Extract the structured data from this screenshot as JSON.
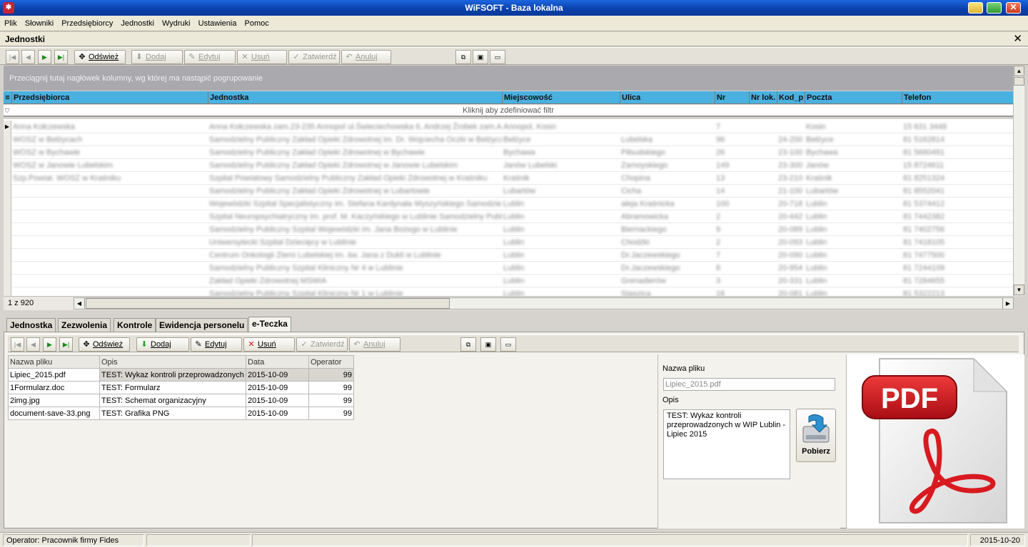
{
  "window": {
    "title": "WiFSOFT - Baza lokalna"
  },
  "menu": [
    "Plik",
    "Słowniki",
    "Przedsiębiorcy",
    "Jednostki",
    "Wydruki",
    "Ustawienia",
    "Pomoc"
  ],
  "panel": {
    "title": "Jednostki"
  },
  "toolbar": {
    "refresh": "Odśwież",
    "add": "Dodaj",
    "edit": "Edytuj",
    "delete": "Usuń",
    "confirm": "Zatwierdź",
    "cancel": "Anuluj"
  },
  "grid": {
    "group_hint": "Przeciągnij tutaj nagłówek kolumny, wg której ma nastąpić pogrupowanie",
    "filter_hint": "Kliknij aby zdefiniować filtr",
    "columns": [
      "Przedsiębiorca",
      "Jednostka",
      "Miejscowość",
      "Ulica",
      "Nr",
      "Nr lok.",
      "Kod_p",
      "Poczta",
      "Telefon"
    ],
    "rows": [
      [
        "Anna Kołczewska",
        "Anna Kołczewska zam.23-235 Annopol ul.Świeciechowska 6, Andrzej Źrobek zam.An",
        "Annopol, Kosin",
        "",
        "7",
        "",
        "",
        "Kosin",
        "15 631 3448"
      ],
      [
        "WOSZ w Bełżycach",
        "Samodzielny Publiczny Zakład Opieki Zdrowotnej im. Dr. Wojciecha Oczki w Bełżycach",
        "Bełżyce",
        "Lubelska",
        "96",
        "",
        "24-200",
        "Bełżyce",
        "81 5162814"
      ],
      [
        "WOSZ w Bychawie",
        "Samodzielny Publiczny Zakład Opieki Zdrowotnej w Bychawie",
        "Bychawa",
        "Piłsudskiego",
        "26",
        "",
        "23-100",
        "Bychawa",
        "81 5660491"
      ],
      [
        "WOSZ w Janowie Lubelskim",
        "Samodzielny Publiczny Zakład Opieki Zdrowotnej w Janowie Lubelskim",
        "Janów Lubelski",
        "Zamoyskiego",
        "149",
        "",
        "23-300",
        "Janów",
        "15 8724611"
      ],
      [
        "Szp.Powiat. WOSZ w Kraśniku",
        "Szpital Powiatowy Samodzielny Publiczny Zakład Opieki Zdrowotnej w Kraśniku",
        "Kraśnik",
        "Chopina",
        "13",
        "",
        "23-210",
        "Kraśnik",
        "81 8251324"
      ],
      [
        "",
        "Samodzielny Publiczny Zakład Opieki Zdrowotnej w Lubartowie",
        "Lubartów",
        "Cicha",
        "14",
        "",
        "21-100",
        "Lubartów",
        "81 8552041"
      ],
      [
        "",
        "Wojewódzki Szpital Specjalistyczny im. Stefana Kardynała Wyszyńskiego Samodzielny",
        "Lublin",
        "aleja Kraśnicka",
        "100",
        "",
        "20-718",
        "Lublin",
        "81 5374412"
      ],
      [
        "",
        "Szpital Neuropsychiatryczny im. prof. M. Kaczyńskiego w Lublinie Samodzielny Publiczny",
        "Lublin",
        "Abramowicka",
        "2",
        "",
        "20-442",
        "Lublin",
        "81 7442382"
      ],
      [
        "",
        "Samodzielny Publiczny Szpital Wojewódzki im. Jana Bożego w Lublinie",
        "Lublin",
        "Biernackiego",
        "9",
        "",
        "20-089",
        "Lublin",
        "81 7402756"
      ],
      [
        "",
        "Uniwersytecki Szpital Dziecięcy w Lublinie",
        "Lublin",
        "Chodźki",
        "2",
        "",
        "20-093",
        "Lublin",
        "81 7418105"
      ],
      [
        "",
        "Centrum Onkologii Ziemi Lubelskiej im. św. Jana z Dukli w Lublinie",
        "Lublin",
        "Dr.Jaczewskiego",
        "7",
        "",
        "20-090",
        "Lublin",
        "81 7477500"
      ],
      [
        "",
        "Samodzielny Publiczny Szpital Kliniczny Nr 4 w Lublinie",
        "Lublin",
        "Dr.Jaczewskiego",
        "8",
        "",
        "20-954",
        "Lublin",
        "81 7244109"
      ],
      [
        "",
        "Zakład Opieki Zdrowotnej MSWiA",
        "Lublin",
        "Grenadierów",
        "3",
        "",
        "20-331",
        "Lublin",
        "81 7284655"
      ],
      [
        "",
        "Samodzielny Publiczny Szpital Kliniczny Nr 1 w Lublinie",
        "Lublin",
        "Staszica",
        "16",
        "",
        "20-081",
        "Lublin",
        "81 5322213"
      ]
    ],
    "counter": "1 z 920"
  },
  "tabs": [
    "Jednostka",
    "Zezwolenia",
    "Kontrole",
    "Ewidencja personelu",
    "e-Teczka"
  ],
  "attachments": {
    "columns": [
      "Nazwa pliku",
      "Opis",
      "Data",
      "Operator"
    ],
    "rows": [
      [
        "Lipiec_2015.pdf",
        "TEST: Wykaz kontroli przeprowadzonych w",
        "2015-10-09",
        "99"
      ],
      [
        "1Formularz.doc",
        "TEST: Formularz",
        "2015-10-09",
        "99"
      ],
      [
        "2img.jpg",
        "TEST: Schemat organizacyjny",
        "2015-10-09",
        "99"
      ],
      [
        "document-save-33.png",
        "TEST: Grafika PNG",
        "2015-10-09",
        "99"
      ]
    ]
  },
  "detail": {
    "filename_label": "Nazwa pliku",
    "filename_value": "Lipiec_2015.pdf",
    "desc_label": "Opis",
    "desc_value": "TEST: Wykaz kontroli przeprowadzonych w WIP Lublin - Lipiec 2015",
    "download": "Pobierz"
  },
  "preview": {
    "badge": "PDF",
    "colors": {
      "badge": "#c8141b",
      "acrobat": "#d81a20"
    }
  },
  "statusbar": {
    "operator": "Operator: Pracownik firmy Fides",
    "date": "2015-10-20"
  }
}
